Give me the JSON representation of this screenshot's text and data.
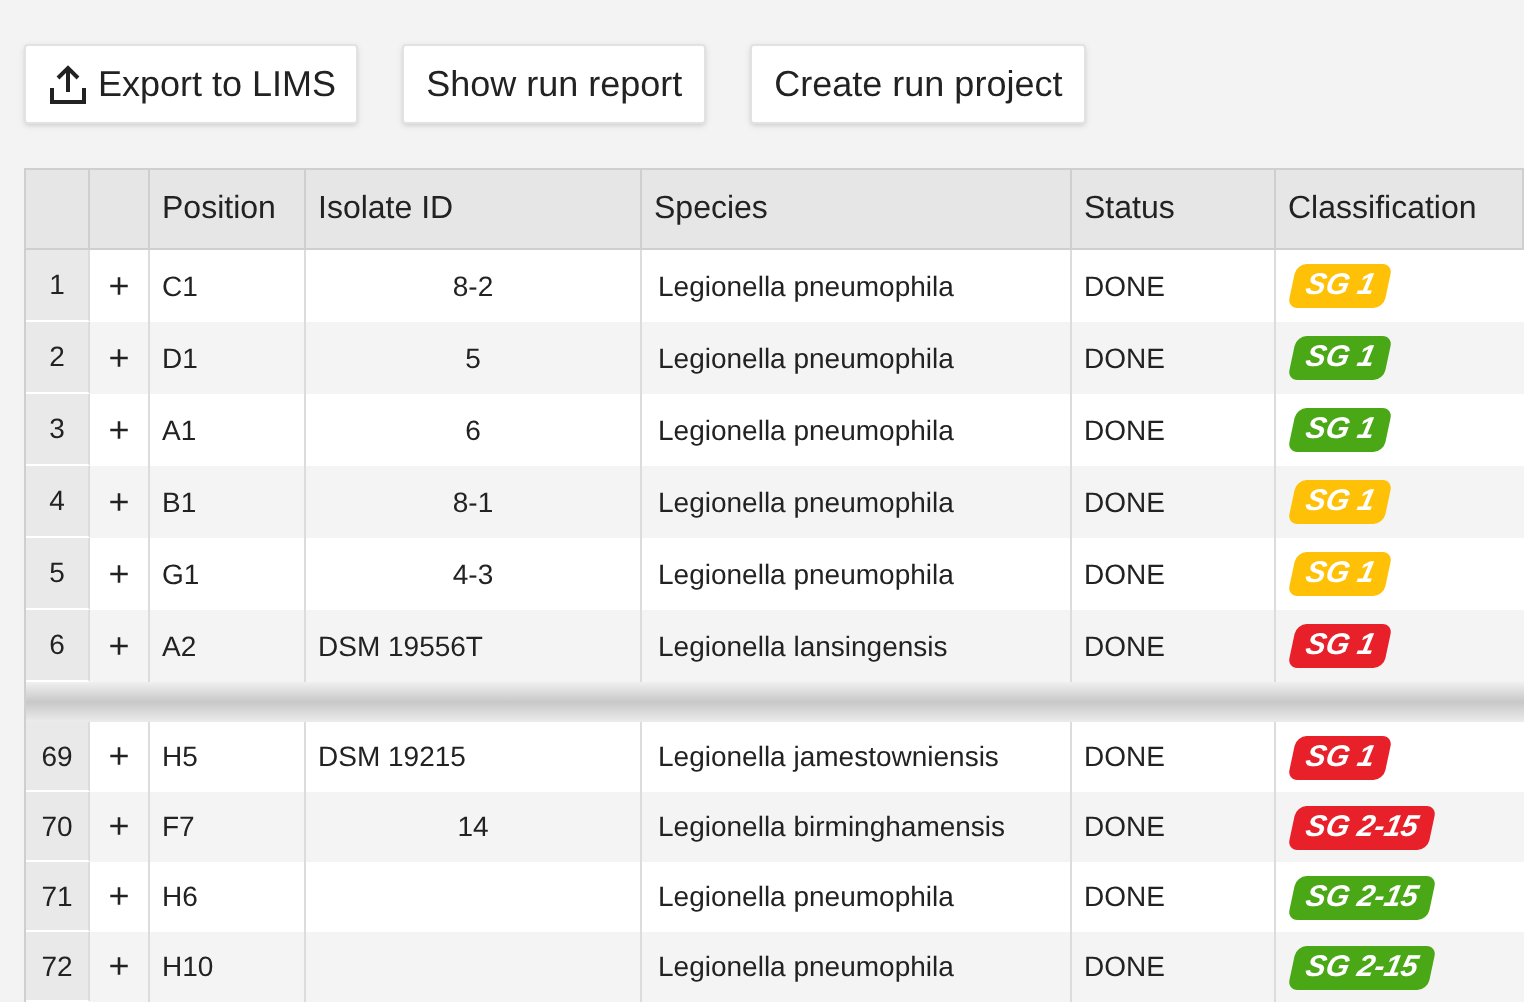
{
  "toolbar": [
    {
      "label": "Export to LIMS",
      "kind": "export"
    },
    {
      "label": "Show run report",
      "kind": "plain"
    },
    {
      "label": "Create run project",
      "kind": "plain"
    }
  ],
  "table": {
    "columns": [
      "Position",
      "Isolate ID",
      "Species",
      "Status",
      "Classification"
    ],
    "groups": [
      [
        {
          "row": "1",
          "expand": "+",
          "position": "C1",
          "isolate_id": "8-2",
          "isolate_centered": true,
          "species": "Legionella pneumophila",
          "status": "DONE",
          "classification": {
            "label": "SG 1",
            "color": "#ffc107"
          }
        },
        {
          "row": "2",
          "expand": "+",
          "position": "D1",
          "isolate_id": "5",
          "isolate_centered": true,
          "species": "Legionella pneumophila",
          "status": "DONE",
          "classification": {
            "label": "SG 1",
            "color": "#4aa816"
          }
        },
        {
          "row": "3",
          "expand": "+",
          "position": "A1",
          "isolate_id": "6",
          "isolate_centered": true,
          "species": "Legionella pneumophila",
          "status": "DONE",
          "classification": {
            "label": "SG 1",
            "color": "#4aa816"
          }
        },
        {
          "row": "4",
          "expand": "+",
          "position": "B1",
          "isolate_id": "8-1",
          "isolate_centered": true,
          "species": "Legionella pneumophila",
          "status": "DONE",
          "classification": {
            "label": "SG 1",
            "color": "#ffc107"
          }
        },
        {
          "row": "5",
          "expand": "+",
          "position": "G1",
          "isolate_id": "4-3",
          "isolate_centered": true,
          "species": "Legionella pneumophila",
          "status": "DONE",
          "classification": {
            "label": "SG 1",
            "color": "#ffc107"
          }
        },
        {
          "row": "6",
          "expand": "+",
          "position": "A2",
          "isolate_id": "DSM 19556T",
          "isolate_centered": false,
          "species": "Legionella lansingensis",
          "status": "DONE",
          "classification": {
            "label": "SG 1",
            "color": "#e8202a"
          }
        }
      ],
      [
        {
          "row": "69",
          "expand": "+",
          "position": "H5",
          "isolate_id": "DSM 19215",
          "isolate_centered": false,
          "species": "Legionella jamestowniensis",
          "status": "DONE",
          "classification": {
            "label": "SG 1",
            "color": "#e8202a"
          }
        },
        {
          "row": "70",
          "expand": "+",
          "position": "F7",
          "isolate_id": "14",
          "isolate_centered": true,
          "species": "Legionella birminghamensis",
          "status": "DONE",
          "classification": {
            "label": "SG 2-15",
            "color": "#e8202a"
          }
        },
        {
          "row": "71",
          "expand": "+",
          "position": "H6",
          "species": "Legionella pneumophila",
          "status": "DONE",
          "classification": {
            "label": "SG 2-15",
            "color": "#4aa816"
          }
        },
        {
          "row": "72",
          "expand": "+",
          "position": "H10",
          "species": "Legionella pneumophila",
          "status": "DONE",
          "classification": {
            "label": "SG 2-15",
            "color": "#4aa816"
          }
        }
      ]
    ]
  }
}
